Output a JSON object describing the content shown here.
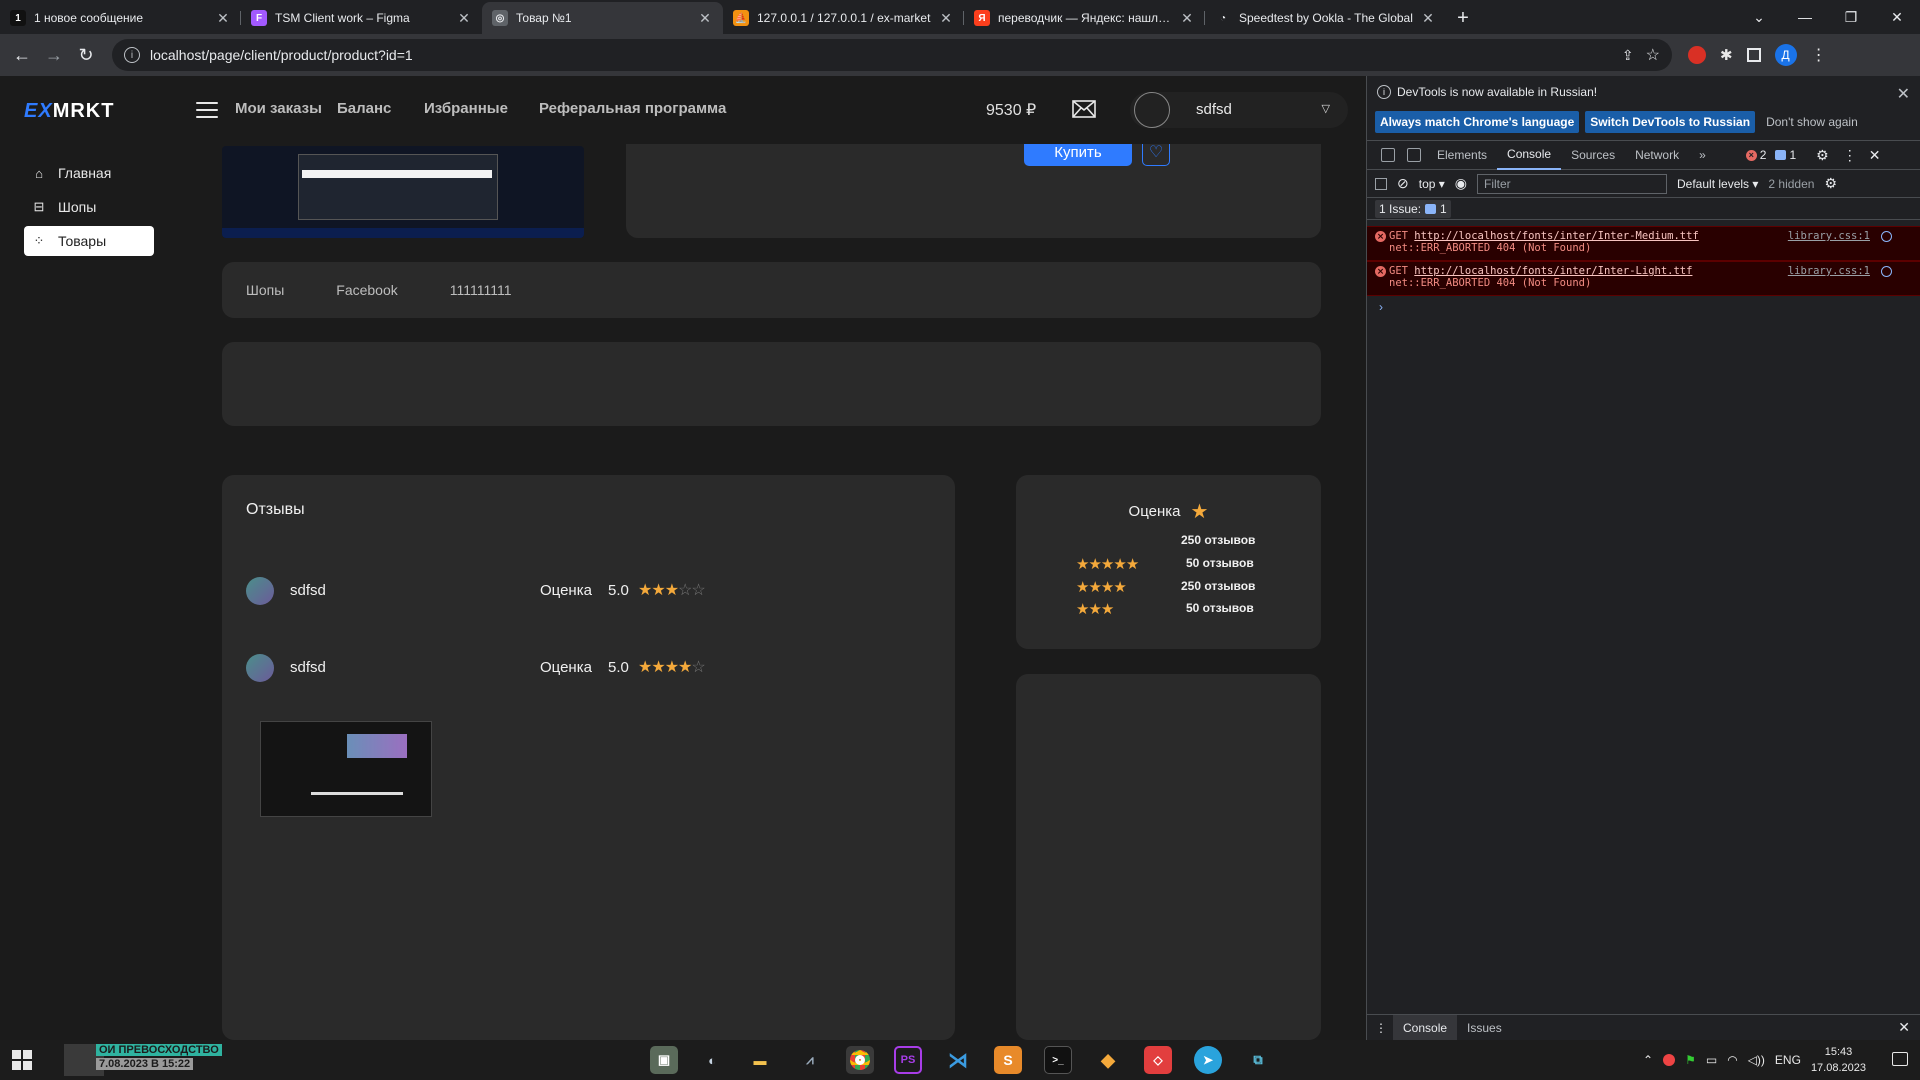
{
  "browser": {
    "tabs": [
      {
        "title": "1 новое сообщение",
        "fav_char": "1",
        "fav_color": "#111111",
        "fav_fg": "#ffffff"
      },
      {
        "title": "TSM Client work – Figma",
        "fav_char": "F",
        "fav_color": "#a259ff",
        "fav_fg": "#ffffff"
      },
      {
        "title": "Товар №1",
        "fav_char": "◎",
        "fav_color": "#5f6368",
        "fav_fg": "#e8eaed"
      },
      {
        "title": "127.0.0.1 / 127.0.0.1 / ex-market",
        "fav_char": "⛵",
        "fav_color": "#f29111",
        "fav_fg": "#202124"
      },
      {
        "title": "переводчик — Яндекс: нашлось",
        "fav_char": "Я",
        "fav_color": "#fc3f1d",
        "fav_fg": "#ffffff"
      },
      {
        "title": "Speedtest by Ookla - The Global",
        "fav_char": "◔",
        "fav_color": "#202124",
        "fav_fg": "#e8eaed"
      }
    ],
    "active_tab_index": 2,
    "url": "localhost/page/client/product/product?id=1",
    "profile_initial": "Д"
  },
  "site": {
    "logo_ex": "EX",
    "logo_rest": "MRKT",
    "nav": [
      "Мои заказы",
      "Баланс",
      "Избранные",
      "Реферальная программа"
    ],
    "balance": "9530 ₽",
    "username": "sdfsd",
    "sidebar": [
      {
        "label": "Главная",
        "icon": "home-icon"
      },
      {
        "label": "Шопы",
        "icon": "shop-icon"
      },
      {
        "label": "Товары",
        "icon": "grid-icon",
        "active": true
      }
    ],
    "buy_label": "Купить",
    "breadcrumbs": [
      "Шопы",
      "Facebook",
      "111111111"
    ],
    "reviews": {
      "title": "Отзывы",
      "items": [
        {
          "name": "sdfsd",
          "label": "Оценка",
          "value": "5.0",
          "stars": 3
        },
        {
          "name": "sdfsd",
          "label": "Оценка",
          "value": "5.0",
          "stars": 4
        }
      ]
    },
    "rating": {
      "title": "Оценка",
      "rows": [
        {
          "stars": 0,
          "count": "250 отзывов"
        },
        {
          "stars": 5,
          "count": "50 отзывов"
        },
        {
          "stars": 4,
          "count": "250 отзывов"
        },
        {
          "stars": 3,
          "count": "50 отзывов"
        }
      ]
    },
    "star_color": "#f4a93b",
    "accent": "#2f7bff"
  },
  "devtools": {
    "notice": "DevTools is now available in Russian!",
    "notice_buttons": [
      "Always match Chrome's language",
      "Switch DevTools to Russian",
      "Don't show again"
    ],
    "tabs": [
      "Elements",
      "Console",
      "Sources",
      "Network"
    ],
    "active_tab": "Console",
    "error_count": "2",
    "msg_count": "1",
    "context": "top",
    "filter_placeholder": "Filter",
    "levels": "Default levels",
    "hidden": "2 hidden",
    "issues_label": "1 Issue:",
    "issues_count": "1",
    "logs": [
      {
        "method": "GET",
        "url": "http://localhost/fonts/inter/Inter-Medium.ttf",
        "error": "net::ERR_ABORTED 404 (Not Found)",
        "source": "library.css:1"
      },
      {
        "method": "GET",
        "url": "http://localhost/fonts/inter/Inter-Light.ttf",
        "error": "net::ERR_ABORTED 404 (Not Found)",
        "source": "library.css:1"
      }
    ],
    "drawer_tabs": [
      "Console",
      "Issues"
    ]
  },
  "taskbar": {
    "news_line1": "ОИ ПРЕВОСХОДСТВО",
    "news_line2": "7.08.2023 В 15:22",
    "lang": "ENG",
    "time": "15:43",
    "date": "17.08.2023"
  }
}
